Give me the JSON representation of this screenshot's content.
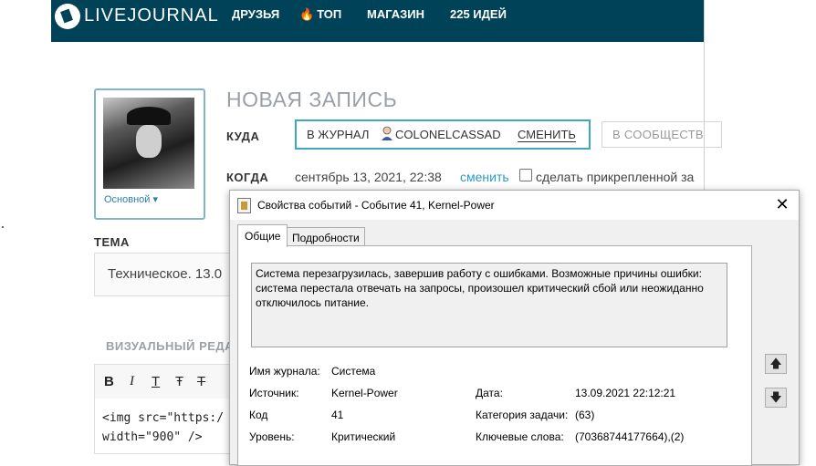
{
  "lj": {
    "logo": "LIVEJOURNAL",
    "nav": [
      "ДРУЗЬЯ",
      "ТОП",
      "МАГАЗИН",
      "225 ИДЕЙ"
    ]
  },
  "post": {
    "title": "НОВАЯ ЗАПИСЬ",
    "where_label": "КУДА",
    "to_journal": "В ЖУРНАЛ",
    "journal_user": "COLONELCASSAD",
    "change": "СМЕНИТЬ",
    "to_community": "В СООБЩЕСТВ",
    "when_label": "КОГДА",
    "date": "сентябрь 13, 2021, 22:38",
    "change_date": "сменить",
    "pin_label": "сделать прикрепленной за",
    "avatar_label": "Основной",
    "subject_label": "ТЕМА",
    "subject_value": "Техническое. 13.0",
    "visual_editor": "ВИЗУАЛЬНЫЙ РЕДА",
    "toolbar": [
      "B",
      "I",
      "T",
      "Ŧ",
      "T"
    ],
    "code_lines": [
      "<img src=\"https:/",
      "width=\"900\" />"
    ]
  },
  "dialog": {
    "title": "Свойства событий - Событие 41, Kernel-Power",
    "tabs": [
      "Общие",
      "Подробности"
    ],
    "description": "Система перезагрузилась, завершив работу с ошибками. Возможные причины ошибки: система перестала отвечать на запросы, произошел критический сбой или неожиданно отключилось питание.",
    "fields": {
      "log_name_label": "Имя журнала:",
      "log_name": "Система",
      "source_label": "Источник:",
      "source": "Kernel-Power",
      "date_label": "Дата:",
      "date": "13.09.2021 22:12:21",
      "code_label": "Код",
      "code": "41",
      "task_label": "Категория задачи:",
      "task": "(63)",
      "level_label": "Уровень:",
      "level": "Критический",
      "keywords_label": "Ключевые слова:",
      "keywords": "(70368744177664),(2)"
    }
  },
  "colors": {
    "lj_header": "#004359",
    "accent": "#3ea7c2",
    "link": "#2a9cc7"
  }
}
